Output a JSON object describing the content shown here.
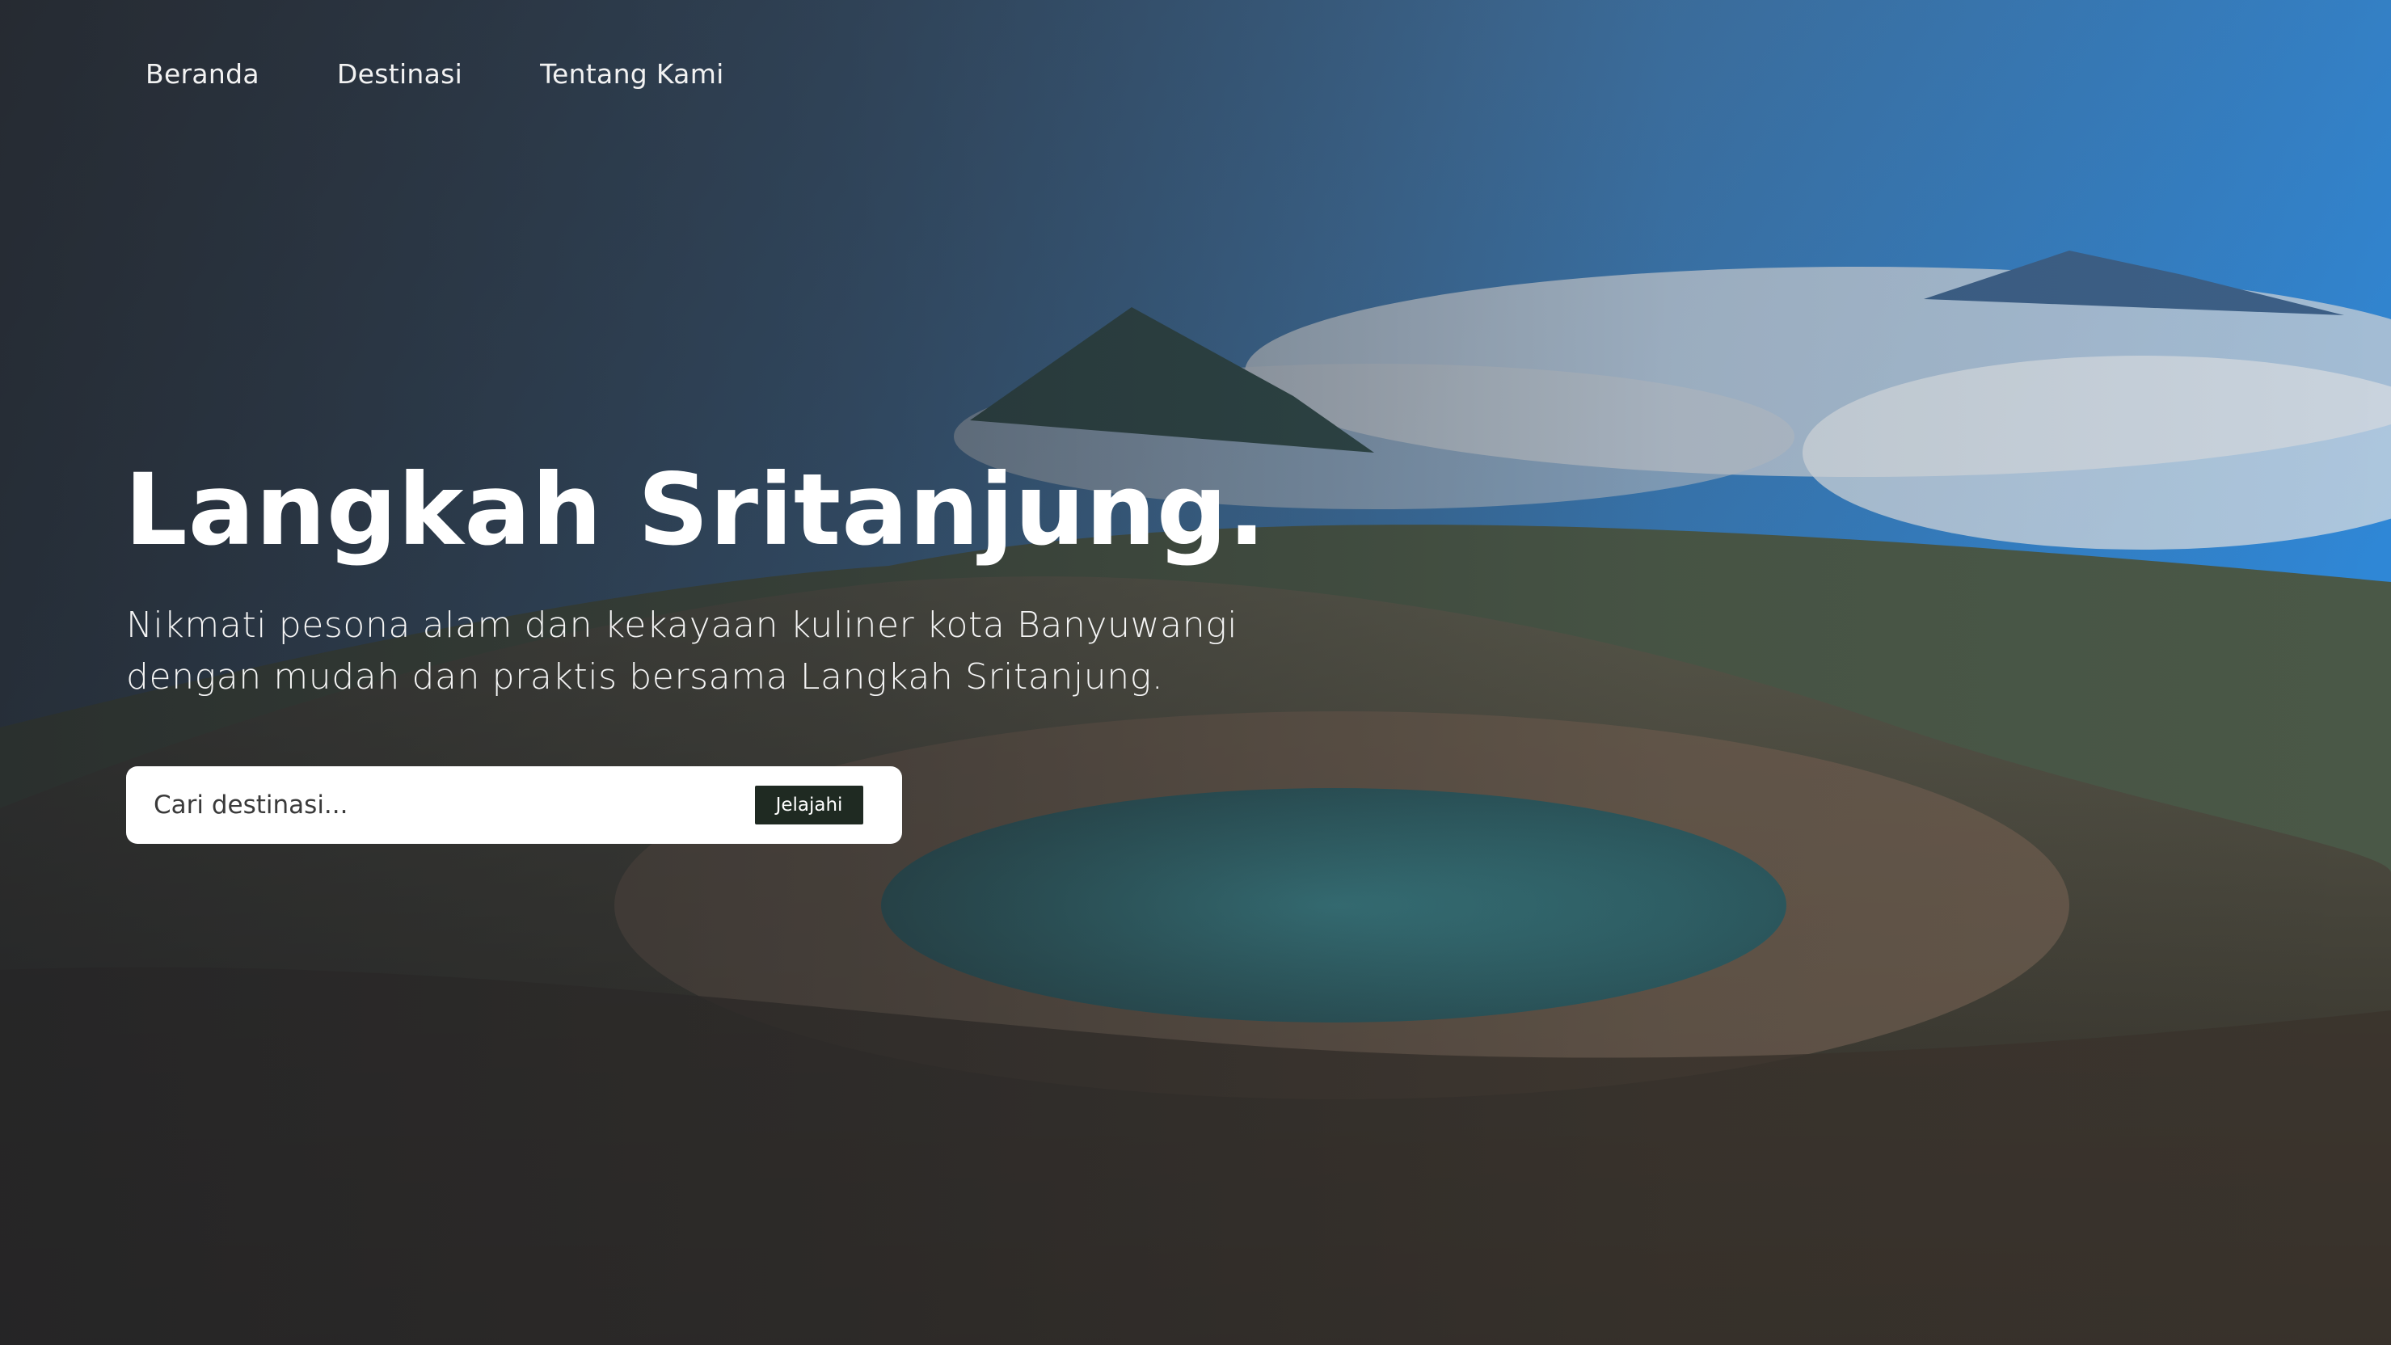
{
  "nav": {
    "items": [
      {
        "label": "Beranda"
      },
      {
        "label": "Destinasi"
      },
      {
        "label": "Tentang Kami"
      }
    ]
  },
  "hero": {
    "title": "Langkah Sritanjung.",
    "subtitle": "Nikmati pesona alam dan kekayaan kuliner kota Banyuwangi dengan mudah dan praktis bersama Langkah Sritanjung."
  },
  "search": {
    "placeholder": "Cari destinasi...",
    "button_label": "Jelajahi"
  },
  "colors": {
    "button_bg": "#1f2a22",
    "text": "#ffffff",
    "search_bg": "#ffffff"
  }
}
